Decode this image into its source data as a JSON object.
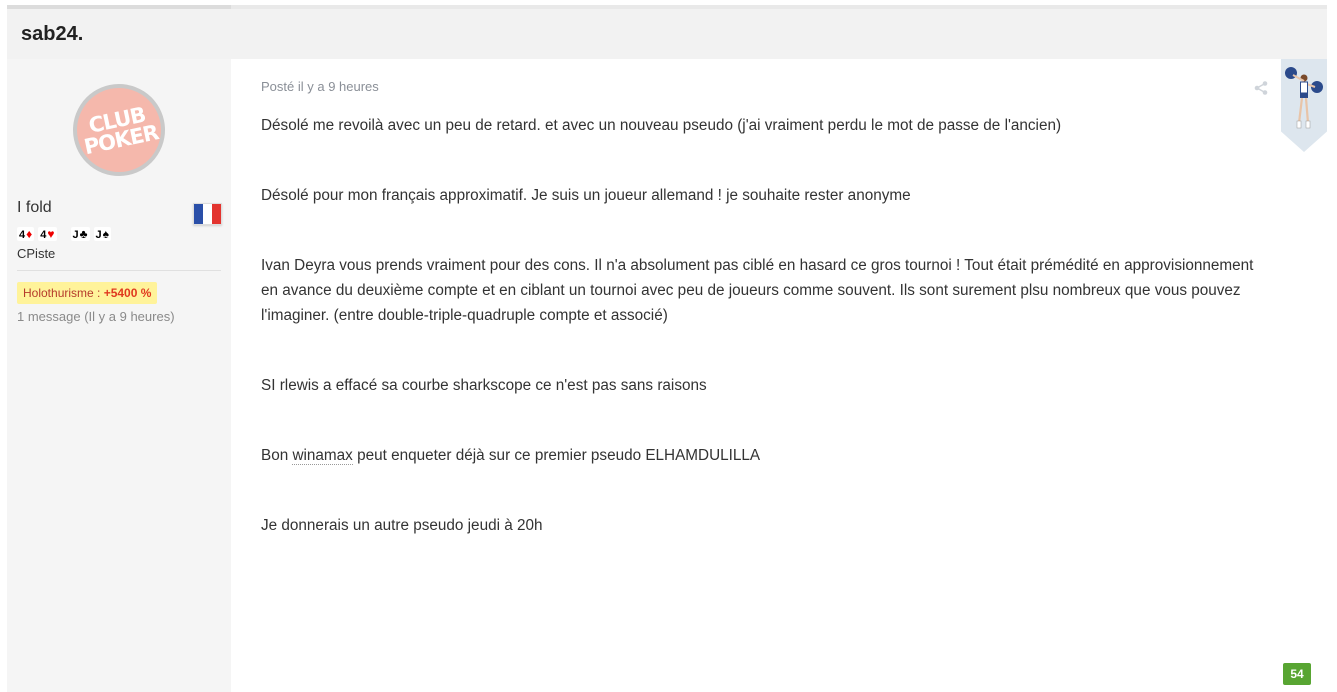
{
  "post": {
    "title": "sab24.",
    "meta": "Posté il y a 9 heures",
    "paragraphs": [
      "Désolé me revoilà avec un peu de retard. et avec un nouveau pseudo (j'ai vraiment perdu le mot de passe de l'ancien)",
      "Désolé pour mon français approximatif. Je suis un joueur allemand ! je souhaite rester anonyme",
      "Ivan Deyra vous prends vraiment pour des cons. Il n'a absolument pas ciblé en hasard ce gros tournoi ! Tout était prémédité en approvisionnement en avance du deuxième compte et en ciblant un tournoi avec peu de joueurs comme souvent. Ils sont surement plsu nombreux que vous pouvez l'imaginer. (entre double-triple-quadruple compte et associé)",
      "SI rlewis a effacé sa courbe sharkscope ce n'est pas sans raisons"
    ],
    "p5_before": "Bon ",
    "p5_link": "winamax",
    "p5_after": " peut enqueter  déjà sur ce premier pseudo  ELHAMDULILLA",
    "p6": "Je donnerais un autre pseudo jeudi à 20h",
    "score": "54"
  },
  "author": {
    "avatar_line1": "CLUB",
    "avatar_line2": "POKER",
    "name": "I fold",
    "country_flag": "france-flag",
    "hand": [
      {
        "rank": "4",
        "suit": "♦",
        "color": "red"
      },
      {
        "rank": "4",
        "suit": "♥",
        "color": "red"
      },
      {
        "rank": "J",
        "suit": "♣",
        "color": "black"
      },
      {
        "rank": "J",
        "suit": "♠",
        "color": "black"
      }
    ],
    "rank_title": "CPiste",
    "badge_label": "Holothurisme : ",
    "badge_value": "+5400 %",
    "post_count": "1 message (Il y a 9 heures)"
  },
  "colors": {
    "score_badge": "#58a532",
    "header_bg": "#f2f2f2",
    "sidebar_bg": "#f5f5f5",
    "badge_bg": "#fff39a",
    "avatar_bg": "#f5b8ac"
  },
  "icons": {
    "share": "share-icon",
    "ribbon": "cheerleader-ribbon-icon"
  }
}
